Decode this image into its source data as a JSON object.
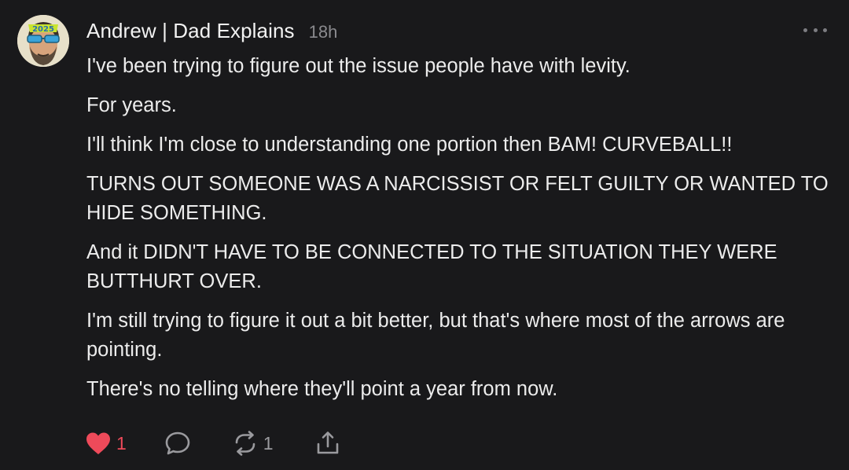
{
  "author": {
    "name": "Andrew | Dad Explains",
    "timestamp": "18h",
    "avatar_icon": "user-avatar",
    "avatar_badge": "2025"
  },
  "menu": {
    "icon": "more-horizontal-icon"
  },
  "body": {
    "paragraphs": [
      "I've been trying to figure out the issue people have with levity.",
      "For years.",
      "I'll think I'm close to understanding one portion then BAM! CURVEBALL!!",
      "TURNS OUT SOMEONE WAS A NARCISSIST OR FELT GUILTY OR WANTED TO HIDE SOMETHING.",
      "And it DIDN'T HAVE TO BE CONNECTED TO THE SITUATION THEY WERE BUTTHURT OVER.",
      "I'm still trying to figure it out a bit better, but that's where most of the arrows are pointing.",
      "There's no telling where they'll point a year from now."
    ]
  },
  "actions": {
    "like": {
      "icon": "heart-icon",
      "count": "1",
      "liked": true
    },
    "comment": {
      "icon": "comment-icon"
    },
    "restack": {
      "icon": "restack-icon",
      "count": "1"
    },
    "share": {
      "icon": "share-icon"
    }
  },
  "colors": {
    "background": "#19191b",
    "text": "#ececec",
    "muted": "#8a8a8e",
    "like": "#ee4a5a"
  }
}
